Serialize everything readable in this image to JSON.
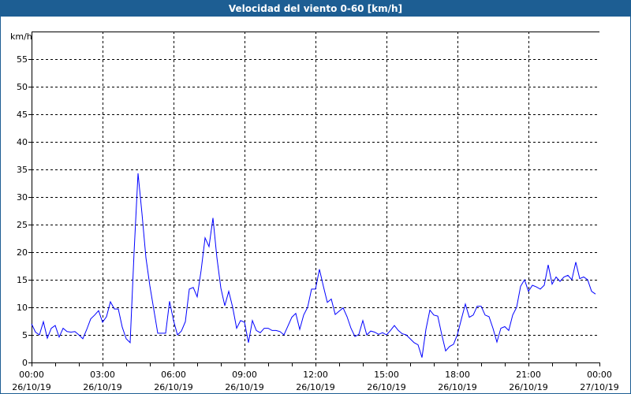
{
  "window": {
    "title": "Velocidad del viento 0-60 [km/h]"
  },
  "colors": {
    "titlebar": "#1d5e93",
    "line": "#0000ff",
    "grid": "#000000"
  },
  "chart_data": {
    "type": "line",
    "title": "Velocidad del viento 0-60 [km/h]",
    "ylabel": "km/h",
    "xlabel": "",
    "ylim": [
      0,
      60
    ],
    "yticks": [
      0,
      5,
      10,
      15,
      20,
      25,
      30,
      35,
      40,
      45,
      50,
      55
    ],
    "xlim_hours": [
      0,
      24
    ],
    "xtick_labels": [
      {
        "time": "00:00",
        "date": "26/10/19"
      },
      {
        "time": "03:00",
        "date": "26/10/19"
      },
      {
        "time": "06:00",
        "date": "26/10/19"
      },
      {
        "time": "09:00",
        "date": "26/10/19"
      },
      {
        "time": "12:00",
        "date": "26/10/19"
      },
      {
        "time": "15:00",
        "date": "26/10/19"
      },
      {
        "time": "18:00",
        "date": "26/10/19"
      },
      {
        "time": "21:00",
        "date": "26/10/19"
      },
      {
        "time": "00:00",
        "date": "27/10/19"
      }
    ],
    "grid": true,
    "interval_minutes": 10,
    "series": [
      {
        "name": "Velocidad del viento",
        "values": [
          7.0,
          5.5,
          5.0,
          7.4,
          4.4,
          6.2,
          6.7,
          4.6,
          6.2,
          5.6,
          5.5,
          5.6,
          5.0,
          4.3,
          6.0,
          7.9,
          8.6,
          9.4,
          7.3,
          8.3,
          11.0,
          9.7,
          9.7,
          6.4,
          4.3,
          3.6,
          20.0,
          34.3,
          27.0,
          19.0,
          13.9,
          9.6,
          5.3,
          5.3,
          5.3,
          11.1,
          7.6,
          5.0,
          5.7,
          7.4,
          13.3,
          13.6,
          11.9,
          16.7,
          22.6,
          21.0,
          26.2,
          19.0,
          13.5,
          10.3,
          12.9,
          10.0,
          6.2,
          7.6,
          7.3,
          3.6,
          7.6,
          5.8,
          5.4,
          6.2,
          6.2,
          5.8,
          5.8,
          5.6,
          5.0,
          6.6,
          8.2,
          8.9,
          6.0,
          8.6,
          10.0,
          13.3,
          13.3,
          16.9,
          13.8,
          10.9,
          11.5,
          8.7,
          9.3,
          9.9,
          8.3,
          6.2,
          4.7,
          5.1,
          7.6,
          5.0,
          5.7,
          5.5,
          5.1,
          5.4,
          5.0,
          5.8,
          6.7,
          5.8,
          5.2,
          5.0,
          4.3,
          3.6,
          3.2,
          0.9,
          6.0,
          9.5,
          8.6,
          8.4,
          5.1,
          2.1,
          2.9,
          3.3,
          5.1,
          7.9,
          10.6,
          8.2,
          8.6,
          10.2,
          10.2,
          8.6,
          8.3,
          6.2,
          3.7,
          6.2,
          6.5,
          5.8,
          8.6,
          10.0,
          13.8,
          15.0,
          12.9,
          14.0,
          13.7,
          13.3,
          14.0,
          17.7,
          14.2,
          15.5,
          14.7,
          15.5,
          15.8,
          15.0,
          18.2,
          15.2,
          15.5,
          15.0,
          12.9,
          12.4
        ]
      }
    ]
  }
}
